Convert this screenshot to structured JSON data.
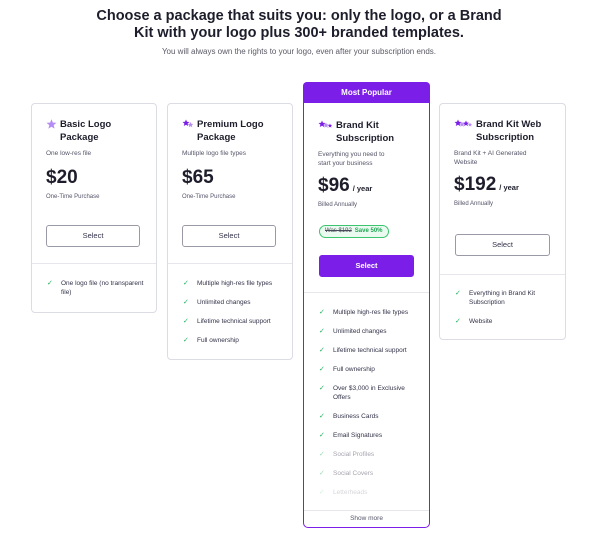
{
  "header": {
    "title_line1": "Choose a package that suits you: only the logo, or a Brand",
    "title_line2": "Kit with your logo plus 300+ branded templates.",
    "subtitle": "You will always own the rights to your logo, even after your subscription ends."
  },
  "plans": [
    {
      "name_line1": "Basic Logo",
      "name_line2": "Package",
      "description": "One low-res file",
      "price": "$20",
      "billing": "One-Time Purchase",
      "button": "Select",
      "features": [
        "One logo file (no transparent file)"
      ],
      "icon": "star-icon"
    },
    {
      "name_line1": "Premium Logo",
      "name_line2": "Package",
      "description": "Multiple logo file types",
      "price": "$65",
      "billing": "One-Time Purchase",
      "button": "Select",
      "features": [
        "Multiple high-res file types",
        "Unlimited changes",
        "Lifetime technical support",
        "Full ownership"
      ],
      "icon": "stars-icon"
    },
    {
      "banner": "Most Popular",
      "name_line1": "Brand Kit",
      "name_line2": "Subscription",
      "description_line1": "Everything you need to",
      "description_line2": "start your business",
      "price": "$96",
      "per": "/ year",
      "billing": "Billed Annually",
      "was": "Was $192",
      "save": "Save 50%",
      "button": "Select",
      "features": [
        "Multiple high-res file types",
        "Unlimited changes",
        "Lifetime technical support",
        "Full ownership",
        "Over $3,000 in Exclusive Offers",
        "Business Cards",
        "Email Signatures",
        "Social Profiles",
        "Social Covers",
        "Letterheads"
      ],
      "show_more": "Show more",
      "icon": "stars-icon"
    },
    {
      "name_line1": "Brand Kit Web",
      "name_line2": "Subscription",
      "description_line1": "Brand Kit + AI Generated",
      "description_line2": "Website",
      "price": "$192",
      "per": "/ year",
      "billing": "Billed Annually",
      "button": "Select",
      "features": [
        "Everything in Brand Kit Subscription",
        "Website"
      ],
      "icon": "stars-icon"
    }
  ],
  "colors": {
    "accent": "#7b1fe8",
    "star_light": "#b58cf5",
    "check": "#22b35e",
    "border": "#dcdce4"
  }
}
